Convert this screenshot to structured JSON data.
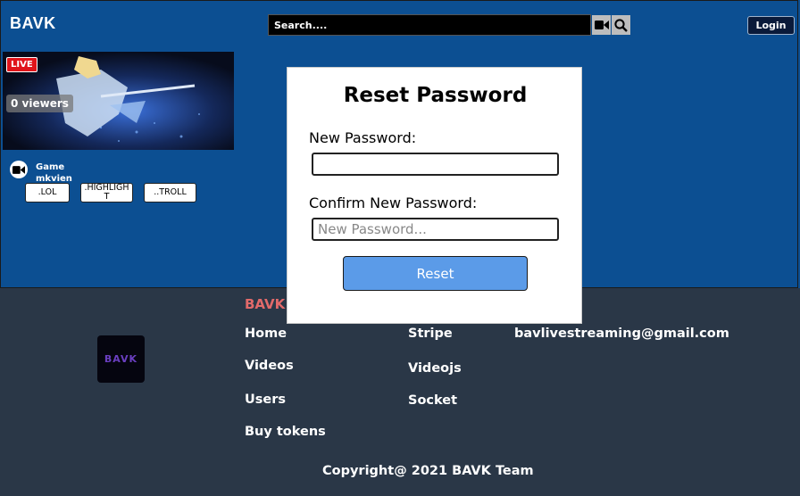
{
  "header": {
    "brand": "BAVK",
    "search_placeholder": "Search....",
    "camera_icon": "video-camera-icon",
    "search_icon": "magnifier-icon",
    "login_label": "Login"
  },
  "stream": {
    "live_badge": "LIVE",
    "viewers": "0 viewers",
    "category": "Game",
    "streamer": "mkvien",
    "tags": [
      ".LOL",
      ".HIGHLIGHT",
      "..TROLL"
    ]
  },
  "modal": {
    "title": "Reset Password",
    "new_password_label": "New Password:",
    "new_password_value": "",
    "confirm_label": "Confirm New Password:",
    "confirm_placeholder": "New Password...",
    "reset_label": "Reset"
  },
  "footer": {
    "brand": "BAVK",
    "logo_text": "BAVK",
    "links_col1": [
      "Home",
      "Videos",
      "Users",
      "Buy tokens"
    ],
    "links_col2": [
      "Stripe",
      "Videojs",
      "Socket"
    ],
    "email": "bavlivestreaming@gmail.com",
    "copyright": "Copyright@ 2021 BAVK Team"
  },
  "colors": {
    "main_bg": "#0c4f92",
    "footer_bg": "#2a3747",
    "accent_button": "#5b9be8",
    "footer_brand": "#e26a6a",
    "live_red": "#e0141a"
  }
}
